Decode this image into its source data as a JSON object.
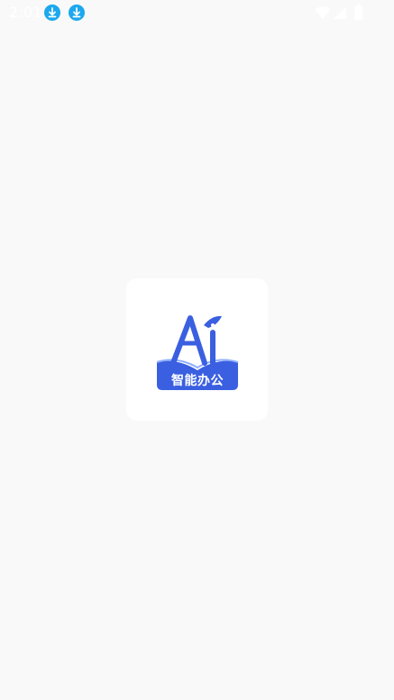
{
  "status_bar": {
    "time": "2:01",
    "notification_icons": [
      "download-icon",
      "download-icon"
    ],
    "system_icons": [
      "wifi-icon",
      "signal-icon",
      "battery-icon"
    ]
  },
  "splash": {
    "logo_text": "智能办公"
  },
  "colors": {
    "background": "#f9f9f9",
    "card": "#ffffff",
    "brand_blue": "#3a5fe0",
    "download_badge": "#1ba8ee"
  }
}
